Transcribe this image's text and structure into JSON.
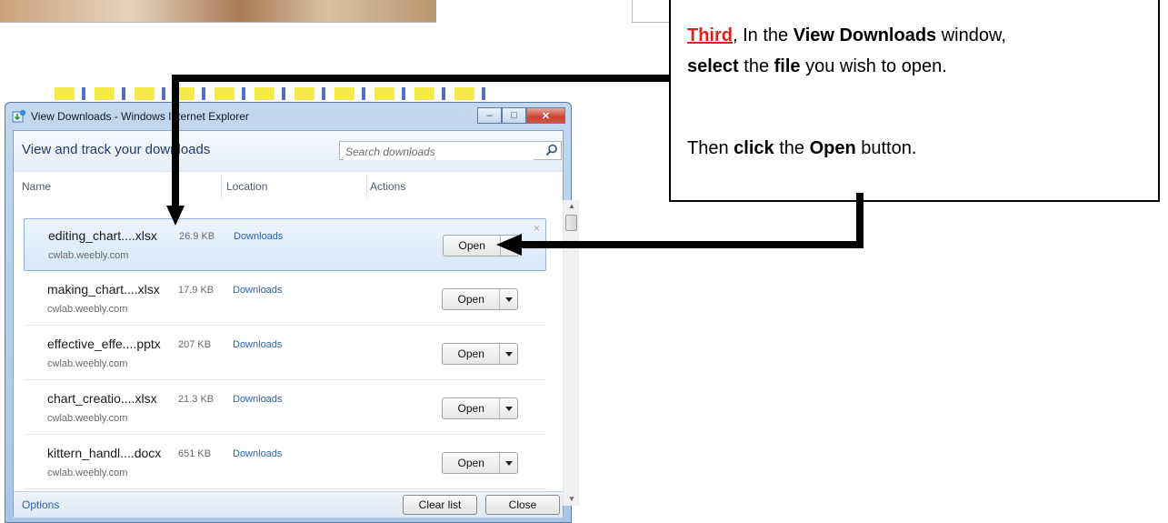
{
  "callout": {
    "third": "Third",
    "t1": ", In the ",
    "view_downloads": "View Downloads",
    "t2": " window,",
    "select": "select",
    "t3": " the ",
    "file": "file",
    "t4": " you wish to open.",
    "t5": "Then ",
    "click": "click",
    "t6": " the ",
    "open": "Open",
    "t7": " button."
  },
  "window": {
    "title": "View Downloads - Windows Internet Explorer",
    "minimize_glyph": "–",
    "maximize_glyph": "□",
    "close_glyph": "✕"
  },
  "header": {
    "title": "View and track your downloads",
    "search_placeholder": "Search downloads"
  },
  "columns": {
    "name": "Name",
    "location": "Location",
    "actions": "Actions"
  },
  "downloads": [
    {
      "name": "editing_chart....xlsx",
      "size": "26.9 KB",
      "site": "cwlab.weebly.com",
      "location": "Downloads",
      "action": "Open",
      "selected": true
    },
    {
      "name": "making_chart....xlsx",
      "size": "17.9 KB",
      "site": "cwlab.weebly.com",
      "location": "Downloads",
      "action": "Open",
      "selected": false
    },
    {
      "name": "effective_effe....pptx",
      "size": "207 KB",
      "site": "cwlab.weebly.com",
      "location": "Downloads",
      "action": "Open",
      "selected": false
    },
    {
      "name": "chart_creatio....xlsx",
      "size": "21.3 KB",
      "site": "cwlab.weebly.com",
      "location": "Downloads",
      "action": "Open",
      "selected": false
    },
    {
      "name": "kittern_handl....docx",
      "size": "651 KB",
      "site": "cwlab.weebly.com",
      "location": "Downloads",
      "action": "Open",
      "selected": false
    }
  ],
  "row_close_glyph": "×",
  "footer": {
    "options": "Options",
    "clear_list": "Clear list",
    "close": "Close"
  },
  "colors": {
    "accent_red": "#e0201a",
    "link_blue": "#2a62b5",
    "selection": "#d7e7fb"
  }
}
